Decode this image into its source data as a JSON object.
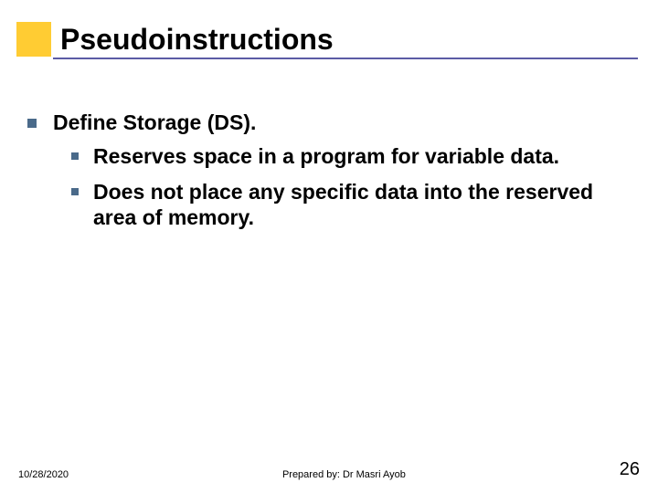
{
  "title": "Pseudoinstructions",
  "bullets": [
    {
      "text": "Define Storage (DS).",
      "sub": [
        "Reserves space in a program for variable data.",
        "Does not place any specific data into the reserved area of memory."
      ]
    }
  ],
  "footer": {
    "date": "10/28/2020",
    "author": "Prepared by: Dr Masri Ayob",
    "page": "26"
  }
}
